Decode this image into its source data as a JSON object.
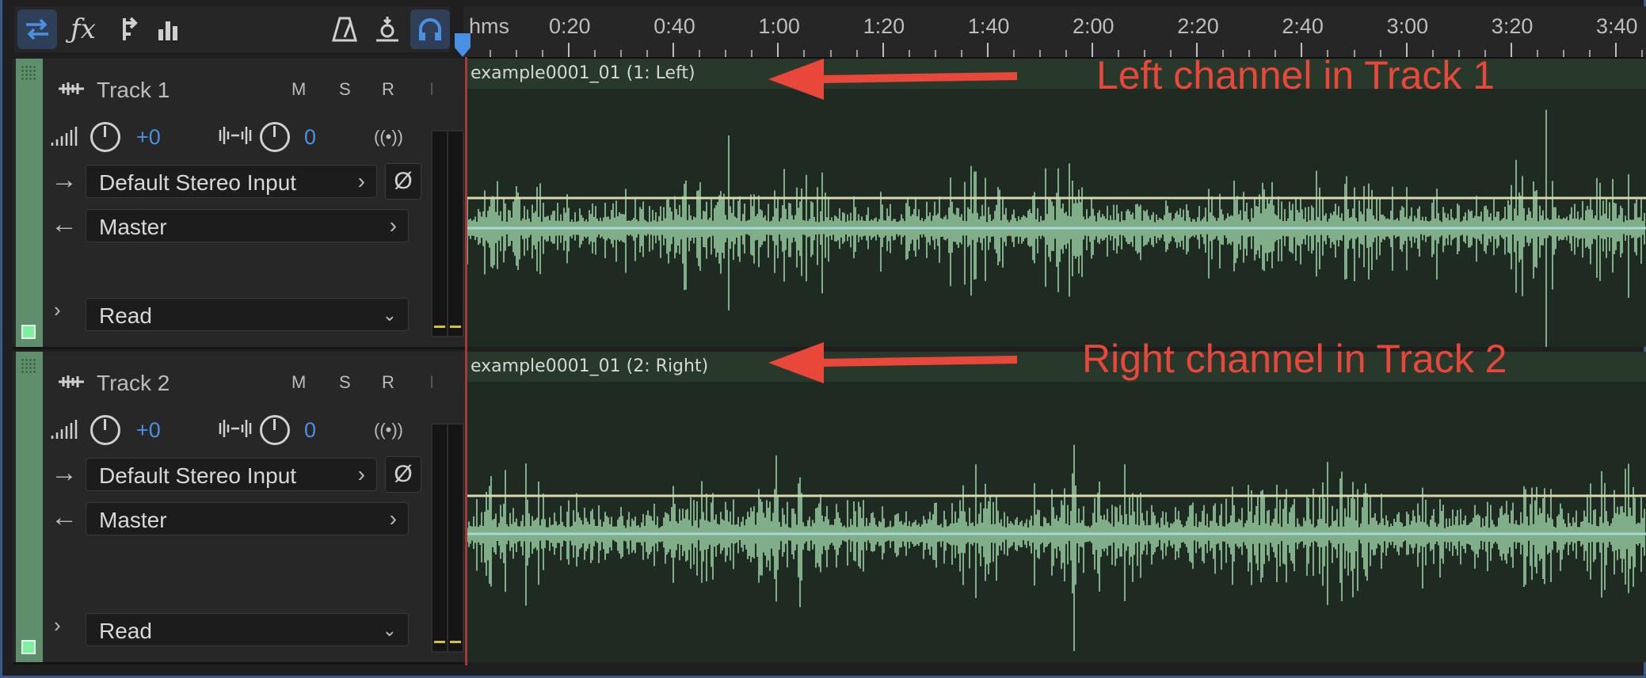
{
  "toolbar": {
    "left_buttons": [
      "switch-icon",
      "fx-icon",
      "send-icon",
      "eq-bars-icon"
    ],
    "right_buttons": [
      "metronome-icon",
      "record-punch-icon",
      "monitor-headphones-icon"
    ]
  },
  "ruler": {
    "unit": "hms",
    "labels": [
      "0:20",
      "0:40",
      "1:00",
      "1:20",
      "1:40",
      "2:00",
      "2:20",
      "2:40",
      "3:00",
      "3:20",
      "3:40"
    ]
  },
  "tracks": [
    {
      "name": "Track 1",
      "m": "M",
      "s": "S",
      "r": "R",
      "i": "I",
      "volume": "+0",
      "pan": "0",
      "input": "Default Stereo Input",
      "output": "Master",
      "automation": "Read",
      "clip_title": "example0001_01 (1: Left)",
      "annotation": "Left channel in Track 1",
      "color": "#5e8e6b"
    },
    {
      "name": "Track 2",
      "m": "M",
      "s": "S",
      "r": "R",
      "i": "I",
      "volume": "+0",
      "pan": "0",
      "input": "Default Stereo Input",
      "output": "Master",
      "automation": "Read",
      "clip_title": "example0001_01 (2: Right)",
      "annotation": "Right channel in Track 2",
      "color": "#5e8e6b"
    }
  ],
  "colors": {
    "accent": "#4a90e2",
    "waveform": "#7fae88",
    "annotation": "#e8473a",
    "playhead": "#a23a3a"
  }
}
